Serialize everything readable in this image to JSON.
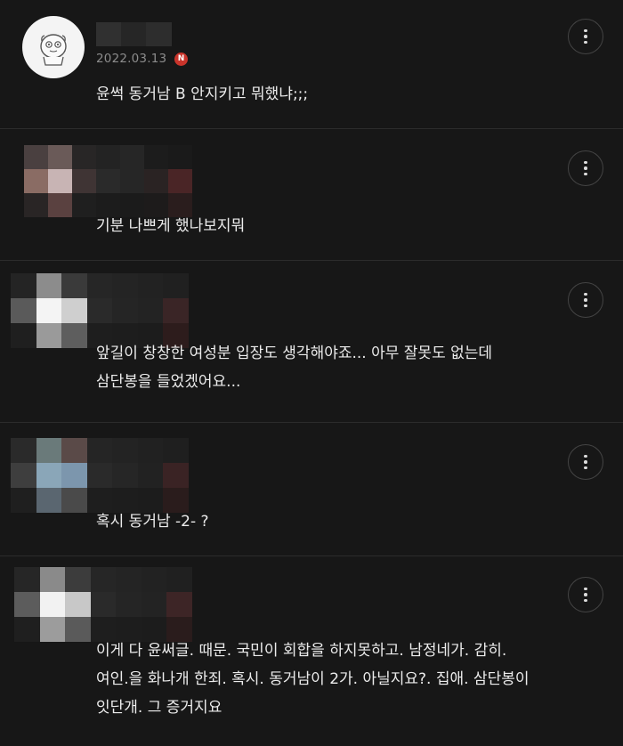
{
  "comments": [
    {
      "author": "",
      "date": "2022.03.13",
      "badge": "N",
      "text": "윤썩 동거남 B 안지키고 뭐했냐;;;",
      "more_icon": "more-vertical-icon"
    },
    {
      "author": "",
      "text": "기분 나쁘게 했나보지뭐",
      "more_icon": "more-vertical-icon"
    },
    {
      "author": "",
      "text": "앞길이 창창한 여성분 입장도 생각해야죠... 아무 잘못도 없는데\n삼단봉을 들었겠어요...",
      "more_icon": "more-vertical-icon"
    },
    {
      "author": "",
      "text": "혹시 동거남 -2- ?",
      "more_icon": "more-vertical-icon"
    },
    {
      "author": "",
      "text": "이게 다 윤써글. 때문. 국민이 회합을 하지못하고. 남정네가. 감히.\n여인.을 화나개 한죄. 혹시. 동거남이 2가. 아닐지요?. 집애. 삼단봉이\n잇단개. 그 증거지요",
      "more_icon": "more-vertical-icon"
    }
  ],
  "colors": {
    "background": "#171717",
    "divider": "#2c2c2c",
    "badge": "#c9342b",
    "date": "#8c8c8c",
    "text": "#ececec"
  }
}
